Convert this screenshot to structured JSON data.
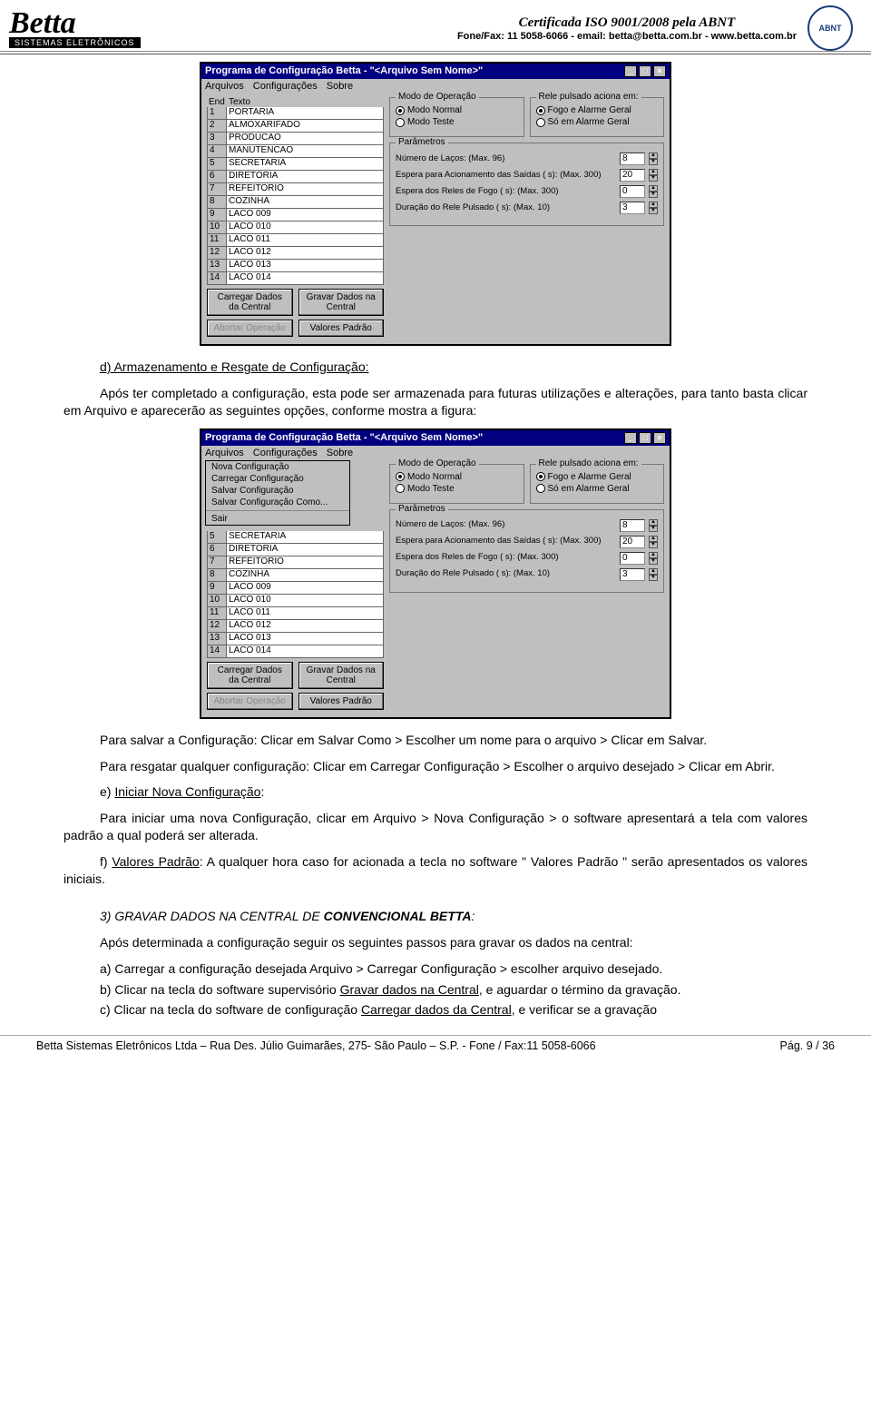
{
  "header": {
    "logo_text": "Betta",
    "logo_sub": "SISTEMAS ELETRÔNICOS",
    "iso_title": "Certificada ISO 9001/2008 pela ABNT",
    "iso_contact": "Fone/Fax: 11 5058-6066 - email: betta@betta.com.br - www.betta.com.br",
    "seal_text": "ABNT"
  },
  "win1": {
    "title": "Programa de Configuração Betta - \"<Arquivo Sem Nome>\"",
    "menus": [
      "Arquivos",
      "Configurações",
      "Sobre"
    ],
    "end_header": {
      "c1": "End",
      "c2": "Texto"
    },
    "rows": [
      {
        "n": "1",
        "t": "PORTARIA"
      },
      {
        "n": "2",
        "t": "ALMOXARIFADO"
      },
      {
        "n": "3",
        "t": "PRODUCAO"
      },
      {
        "n": "4",
        "t": "MANUTENCAO"
      },
      {
        "n": "5",
        "t": "SECRETARIA"
      },
      {
        "n": "6",
        "t": "DIRETORIA"
      },
      {
        "n": "7",
        "t": "REFEITORIO"
      },
      {
        "n": "8",
        "t": "COZINHA"
      },
      {
        "n": "9",
        "t": "LACO 009"
      },
      {
        "n": "10",
        "t": "LACO 010"
      },
      {
        "n": "11",
        "t": "LACO 011"
      },
      {
        "n": "12",
        "t": "LACO 012"
      },
      {
        "n": "13",
        "t": "LACO 013"
      },
      {
        "n": "14",
        "t": "LACO 014"
      }
    ],
    "grp_modo": {
      "title": "Modo de Operação",
      "opt1": "Modo Normal",
      "opt2": "Modo Teste"
    },
    "grp_rele": {
      "title": "Rele pulsado aciona em:",
      "opt1": "Fogo e Alarme Geral",
      "opt2": "Só em Alarme Geral"
    },
    "grp_param": {
      "title": "Parâmetros",
      "p1": {
        "label": "Número de Laços:\n(Max. 96)",
        "val": "8"
      },
      "p2": {
        "label": "Espera para Acionamento das Saídas ( s):\n(Max. 300)",
        "val": "20"
      },
      "p3": {
        "label": "Espera dos Reles de Fogo ( s):\n(Max. 300)",
        "val": "0"
      },
      "p4": {
        "label": "Duração do Rele Pulsado ( s):\n(Max. 10)",
        "val": "3"
      }
    },
    "btn_load": "Carregar Dados da Central",
    "btn_save": "Gravar Dados na Central",
    "btn_abort": "Abortar Operação",
    "btn_default": "Valores Padrão"
  },
  "win2": {
    "title": "Programa de Configuração Betta - \"<Arquivo Sem Nome>\"",
    "menus": [
      "Arquivos",
      "Configurações",
      "Sobre"
    ],
    "filemenu": [
      "Nova Configuração",
      "Carregar Configuração",
      "Salvar Configuração",
      "Salvar Configuração Como...",
      "—",
      "Sair"
    ],
    "rows": [
      {
        "n": "5",
        "t": "SECRETARIA"
      },
      {
        "n": "6",
        "t": "DIRETORIA"
      },
      {
        "n": "7",
        "t": "REFEITORIO"
      },
      {
        "n": "8",
        "t": "COZINHA"
      },
      {
        "n": "9",
        "t": "LACO 009"
      },
      {
        "n": "10",
        "t": "LACO 010"
      },
      {
        "n": "11",
        "t": "LACO 011"
      },
      {
        "n": "12",
        "t": "LACO 012"
      },
      {
        "n": "13",
        "t": "LACO 013"
      },
      {
        "n": "14",
        "t": "LACO 014"
      }
    ]
  },
  "text": {
    "d_head": "d) Armazenamento  e Resgate de Configuração:",
    "d_body": "Após ter completado a configuração, esta pode ser armazenada para futuras utilizações e alterações, para tanto basta clicar em Arquivo e aparecerão as seguintes opções, conforme mostra a figura:",
    "save_pre": "Para salvar a Configuração: Clicar em Salvar Como > Escolher um nome para o arquivo > Clicar em Salvar.",
    "load_pre": "Para resgatar qualquer configuração:  Clicar em Carregar Configuração > Escolher o arquivo desejado > Clicar em Abrir.",
    "e_head_plain": "e) ",
    "e_head_u": "Iniciar Nova Configuração",
    "e_head_colon": ":",
    "e_body": "Para iniciar uma nova Configuração, clicar em Arquivo > Nova Configuração > o software apresentará a tela com valores padrão a qual poderá ser alterada.",
    "f_pre": "f) ",
    "f_u": "Valores Padrão",
    "f_rest": ": A qualquer hora caso for acionada a tecla no software \" Valores Padrão \" serão apresentados os valores iniciais.",
    "sec3_pre": "3)  GRAVAR DADOS NA CENTRAL DE ",
    "sec3_bold": "CONVENCIONAL BETTA",
    "sec3_colon": ":",
    "sec3_intro": "Após determinada a configuração seguir os seguintes passos para gravar os dados na central:",
    "a_line": "a) Carregar a configuração desejada Arquivo > Carregar Configuração > escolher arquivo desejado.",
    "b_pre": "b) Clicar na tecla do software supervisório ",
    "b_u": "Gravar dados na Central",
    "b_rest": ", e aguardar o término da gravação.",
    "c_pre": "c) Clicar na tecla do software de configuração  ",
    "c_u": "Carregar dados da Central",
    "c_rest": ", e verificar se a gravação"
  },
  "footer": {
    "left": "Betta Sistemas Eletrônicos Ltda – Rua Des. Júlio Guimarães, 275- São Paulo – S.P. - Fone / Fax:11 5058-6066",
    "right": "Pág.  9 / 36"
  }
}
